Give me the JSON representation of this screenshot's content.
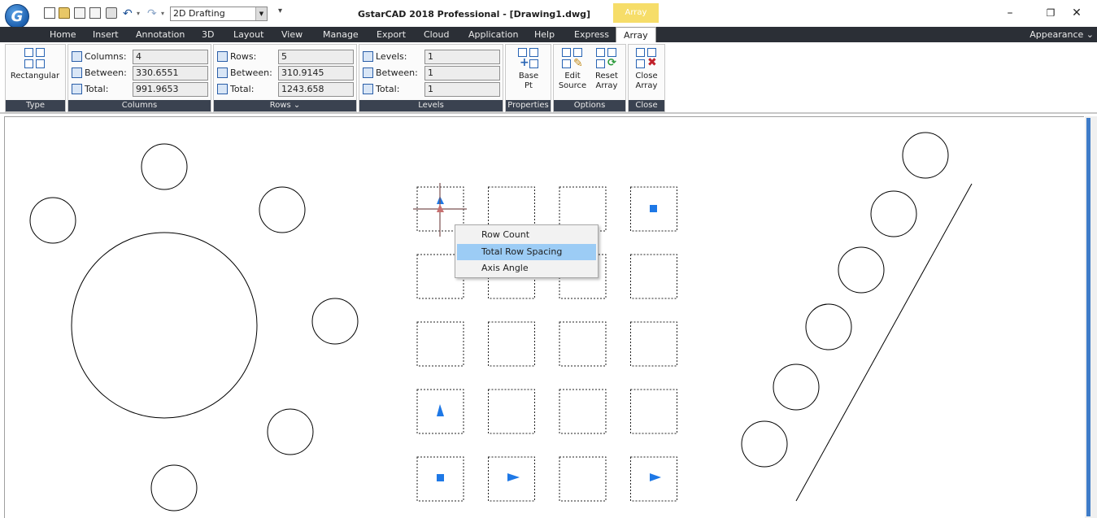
{
  "titlebar": {
    "logo_letter": "G",
    "workspace": "2D Drafting",
    "customize_glyph": "▾",
    "title": "GstarCAD 2018 Professional - [Drawing1.dwg]",
    "context_tab": "Array",
    "min_glyph": "–",
    "restore_glyph": "❐",
    "close_glyph": "✕"
  },
  "tabs": [
    "Home",
    "Insert",
    "Annotation",
    "3D",
    "Layout",
    "View",
    "Manage",
    "Export",
    "Cloud",
    "Application",
    "Help",
    "Express",
    "Array"
  ],
  "appearance_label": "Appearance",
  "ribbon": {
    "type_panel": {
      "button": "Rectangular",
      "footer": "Type"
    },
    "columns_panel": {
      "columns_label": "Columns:",
      "columns_value": "4",
      "between_label": "Between:",
      "between_value": "330.6551",
      "total_label": "Total:",
      "total_value": "991.9653",
      "footer": "Columns"
    },
    "rows_panel": {
      "rows_label": "Rows:",
      "rows_value": "5",
      "between_label": "Between:",
      "between_value": "310.9145",
      "total_label": "Total:",
      "total_value": "1243.658",
      "footer": "Rows ⌄"
    },
    "levels_panel": {
      "levels_label": "Levels:",
      "levels_value": "1",
      "between_label": "Between:",
      "between_value": "1",
      "total_label": "Total:",
      "total_value": "1",
      "footer": "Levels"
    },
    "properties_panel": {
      "base_line1": "Base",
      "base_line2": "Pt",
      "footer": "Properties"
    },
    "options_panel": {
      "edit_line1": "Edit",
      "edit_line2": "Source",
      "reset_line1": "Reset",
      "reset_line2": "Array",
      "footer": "Options"
    },
    "close_panel": {
      "close_line1": "Close",
      "close_line2": "Array",
      "footer": "Close"
    }
  },
  "context_menu": {
    "items": [
      "Row Count",
      "Total Row Spacing",
      "Axis Angle"
    ],
    "highlighted_index": 1,
    "highlight_color": "#9cccf5"
  },
  "colors": {
    "tab_bar": "#2b2f36",
    "panel_footer": "#3a4250",
    "grip": "#1e78e6",
    "context_tab": "#f6dd69"
  },
  "drawing": {
    "array_rows": 5,
    "array_columns": 4
  }
}
